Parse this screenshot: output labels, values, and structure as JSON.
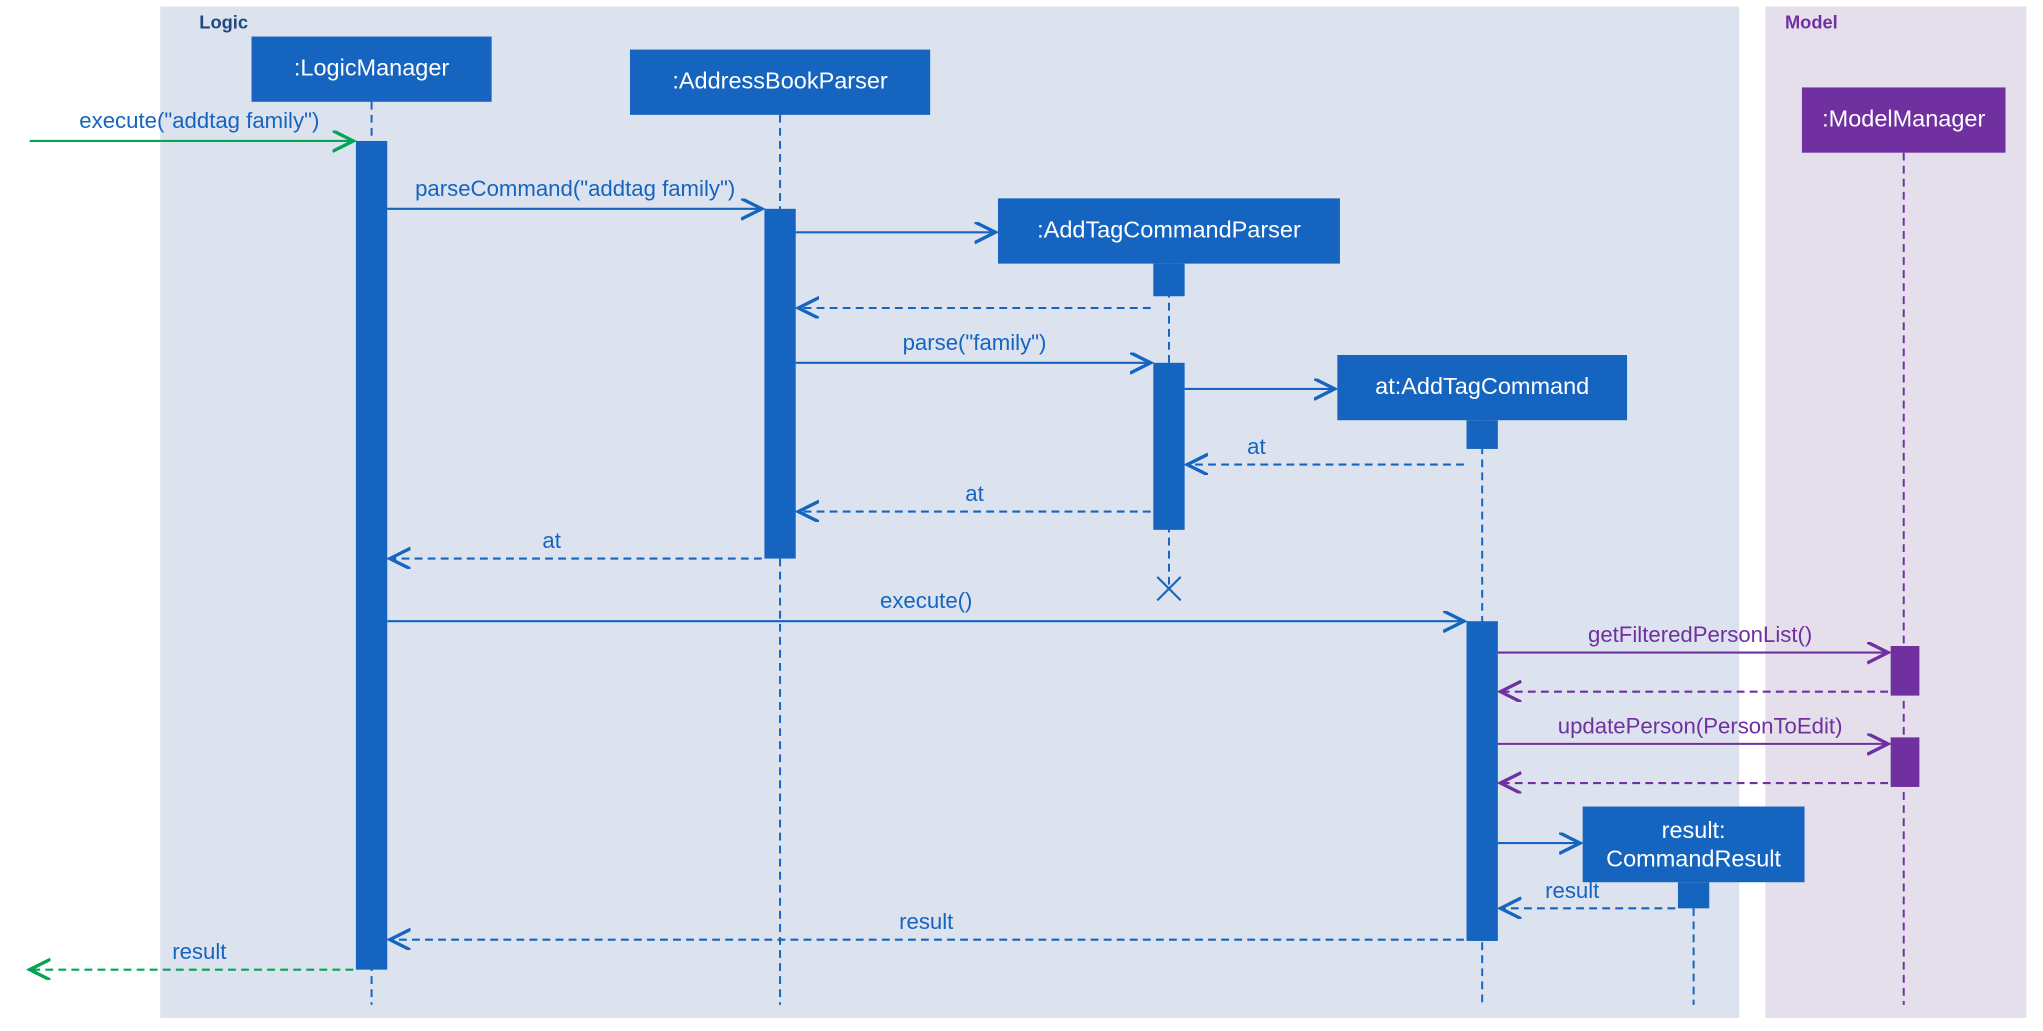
{
  "frames": {
    "logic": "Logic",
    "model": "Model"
  },
  "objects": {
    "logicManager": ":LogicManager",
    "addressBookParser": ":AddressBookParser",
    "addTagCommandParser": ":AddTagCommandParser",
    "addTagCommand": "at:AddTagCommand",
    "commandResultLine1": "result:",
    "commandResultLine2": "CommandResult",
    "modelManager": ":ModelManager"
  },
  "messages": {
    "executeIn": "execute(\"addtag family\")",
    "parseCommand": "parseCommand(\"addtag family\")",
    "parse": "parse(\"family\")",
    "atReturn1": "at",
    "atReturn2": "at",
    "atReturn3": "at",
    "execute": "execute()",
    "getFiltered": "getFilteredPersonList()",
    "updatePerson": "updatePerson(PersonToEdit)",
    "resultReturn1": "result",
    "resultReturn2": "result",
    "resultOut": "result"
  },
  "colors": {
    "blue": "#1565c0",
    "purple": "#7030a0",
    "green": "#00a651",
    "logicBg": "#dce3ef",
    "modelBg": "#e5dfec"
  }
}
